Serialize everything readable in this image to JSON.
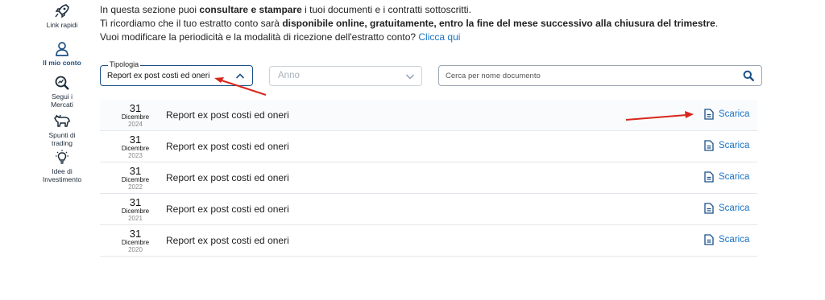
{
  "sidebar": {
    "items": [
      {
        "label": "Link rapidi",
        "icon": "rocket-icon"
      },
      {
        "label": "Il mio conto",
        "icon": "user-icon",
        "active": true
      },
      {
        "label": "Segui i Mercati",
        "icon": "chart-magnifier-icon"
      },
      {
        "label": "Spunti di trading",
        "icon": "bull-icon"
      },
      {
        "label": "Idee di Investimento",
        "icon": "lightbulb-icon"
      }
    ]
  },
  "intro": {
    "line1_pre": "In questa sezione puoi ",
    "line1_bold": "consultare e stampare",
    "line1_post": " i tuoi documenti e i contratti sottoscritti.",
    "line2_pre": "Ti ricordiamo che il tuo estratto conto sarà ",
    "line2_bold": "disponibile online, gratuitamente, entro la fine del mese successivo alla chiusura del trimestre",
    "line2_post": ".",
    "line3_pre": "Vuoi modificare la periodicità e la modalità di ricezione dell'estratto conto? ",
    "line3_link": "Clicca qui"
  },
  "filters": {
    "tipologia_label": "Tipologia",
    "tipologia_value": "Report ex post costi ed oneri",
    "anno_placeholder": "Anno",
    "search_placeholder": "Cerca per nome documento"
  },
  "documents": [
    {
      "day": "31",
      "month": "Dicembre",
      "year": "2024",
      "name": "Report ex post costi ed oneri",
      "action": "Scarica"
    },
    {
      "day": "31",
      "month": "Dicembre",
      "year": "2023",
      "name": "Report ex post costi ed oneri",
      "action": "Scarica"
    },
    {
      "day": "31",
      "month": "Dicembre",
      "year": "2022",
      "name": "Report ex post costi ed oneri",
      "action": "Scarica"
    },
    {
      "day": "31",
      "month": "Dicembre",
      "year": "2021",
      "name": "Report ex post costi ed oneri",
      "action": "Scarica"
    },
    {
      "day": "31",
      "month": "Dicembre",
      "year": "2020",
      "name": "Report ex post costi ed oneri",
      "action": "Scarica"
    }
  ],
  "colors": {
    "accent": "#1a4f86",
    "link": "#1a73c4",
    "annotation_arrow": "#d9261c"
  }
}
